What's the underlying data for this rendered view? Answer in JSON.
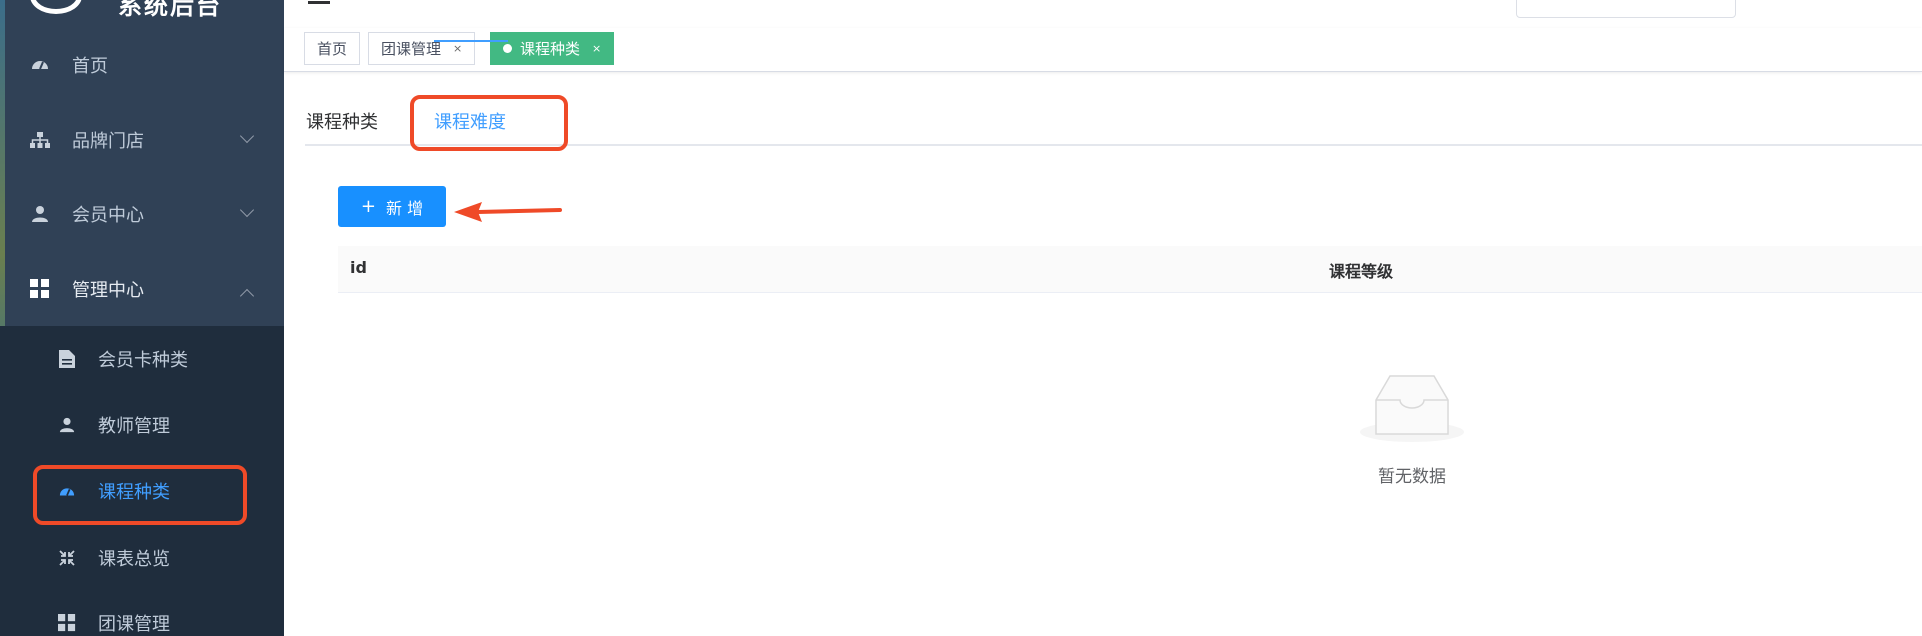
{
  "app": {
    "logo_text": "系统后台"
  },
  "sidebar": {
    "items": [
      {
        "label": "首页",
        "icon": "dashboard-icon"
      },
      {
        "label": "品牌门店",
        "icon": "sitemap-icon"
      },
      {
        "label": "会员中心",
        "icon": "user-icon"
      },
      {
        "label": "管理中心",
        "icon": "grid-icon"
      }
    ],
    "submenu": [
      {
        "label": "会员卡种类",
        "icon": "document-icon"
      },
      {
        "label": "教师管理",
        "icon": "user-icon"
      },
      {
        "label": "课程种类",
        "icon": "dashboard-icon",
        "active": true
      },
      {
        "label": "课表总览",
        "icon": "shrink-icon"
      },
      {
        "label": "团课管理",
        "icon": "grid-icon"
      }
    ]
  },
  "tags": {
    "items": [
      {
        "label": "首页"
      },
      {
        "label": "团课管理",
        "close": "×"
      },
      {
        "label": "课程种类",
        "close": "×",
        "active": true
      }
    ]
  },
  "tabs": {
    "items": [
      {
        "label": "课程种类"
      },
      {
        "label": "课程难度",
        "active": true
      }
    ]
  },
  "toolbar": {
    "add_label": "新 增",
    "add_icon": "+"
  },
  "table": {
    "columns": [
      "id",
      "课程等级"
    ],
    "empty_text": "暂无数据"
  },
  "colors": {
    "accent": "#409eff",
    "highlight": "#ef4a28",
    "tag_active": "#42b983",
    "sidebar_bg": "#304156"
  }
}
